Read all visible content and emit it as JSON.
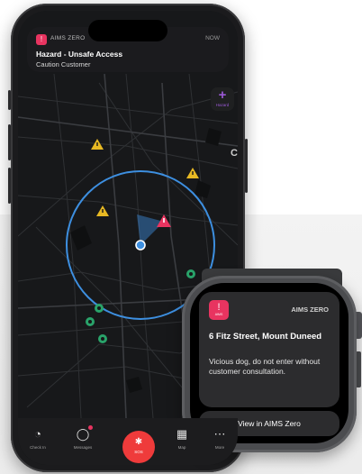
{
  "notification": {
    "app": "AIMS ZERO",
    "time": "NOW",
    "title": "Hazard - Unsafe Access",
    "body": "Caution Customer"
  },
  "map": {
    "fab_label": "Hazard",
    "edge_letter": "C",
    "hazard_warning_count": 4,
    "hazard_alert_count": 1,
    "safe_site_count": 5,
    "colors": {
      "warning": "#e8b923",
      "alert": "#e83460",
      "safe": "#29a36a",
      "geofence": "#3d8fe0",
      "accent": "#9b59d6"
    }
  },
  "bottom_nav": {
    "check_in": "Check In",
    "messages": "Messages",
    "sos": "SOS",
    "map": "Map",
    "more": "More"
  },
  "watch": {
    "app": "AIMS ZERO",
    "icon_text": "AIMS",
    "title": "6 Fitz Street, Mount Duneed",
    "body": "Vicious dog, do not enter without customer consultation.",
    "button": "View in AIMS Zero"
  }
}
